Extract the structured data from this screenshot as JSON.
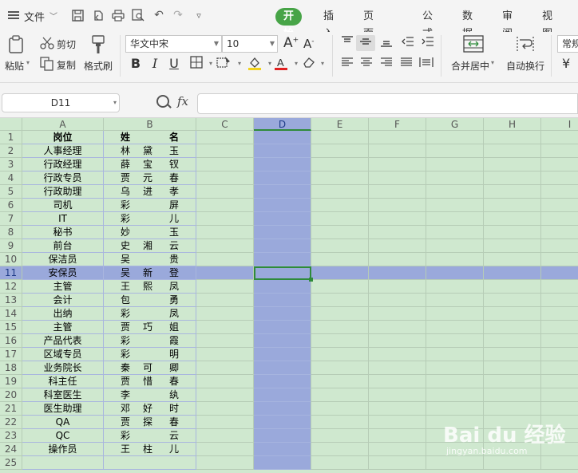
{
  "menubar": {
    "file_label": "文件",
    "tabs": [
      "开始",
      "插入",
      "页面布局",
      "公式",
      "数据",
      "审阅",
      "视图"
    ],
    "active_tab": "开始"
  },
  "ribbon": {
    "paste": "粘贴",
    "cut": "剪切",
    "copy": "复制",
    "format_painter": "格式刷",
    "font_name": "华文中宋",
    "font_size": "10",
    "merge_center": "合并居中",
    "wrap_text": "自动换行",
    "number_format": "常规"
  },
  "formula_bar": {
    "cell_ref": "D11",
    "fx": "fx",
    "formula": ""
  },
  "grid": {
    "columns": [
      "A",
      "B",
      "C",
      "D",
      "E",
      "F",
      "G",
      "H",
      "I"
    ],
    "selected_column": "D",
    "selected_row": 11,
    "header_row": {
      "position": "岗位",
      "name": "姓名"
    },
    "rows": [
      {
        "row": 2,
        "position": "人事经理",
        "name": [
          "林",
          "黛",
          "玉"
        ]
      },
      {
        "row": 3,
        "position": "行政经理",
        "name": [
          "薛",
          "宝",
          "钗"
        ]
      },
      {
        "row": 4,
        "position": "行政专员",
        "name": [
          "贾",
          "元",
          "春"
        ]
      },
      {
        "row": 5,
        "position": "行政助理",
        "name": [
          "乌",
          "进",
          "孝"
        ]
      },
      {
        "row": 6,
        "position": "司机",
        "name": [
          "彩",
          "",
          "屏"
        ]
      },
      {
        "row": 7,
        "position": "IT",
        "name": [
          "彩",
          "",
          "儿"
        ]
      },
      {
        "row": 8,
        "position": "秘书",
        "name": [
          "妙",
          "",
          "玉"
        ]
      },
      {
        "row": 9,
        "position": "前台",
        "name": [
          "史",
          "湘",
          "云"
        ]
      },
      {
        "row": 10,
        "position": "保洁员",
        "name": [
          "吴",
          "",
          "贵"
        ]
      },
      {
        "row": 11,
        "position": "安保员",
        "name": [
          "吴",
          "新",
          "登"
        ]
      },
      {
        "row": 12,
        "position": "主管",
        "name": [
          "王",
          "熙",
          "凤"
        ]
      },
      {
        "row": 13,
        "position": "会计",
        "name": [
          "包",
          "",
          "勇"
        ]
      },
      {
        "row": 14,
        "position": "出纳",
        "name": [
          "彩",
          "",
          "凤"
        ]
      },
      {
        "row": 15,
        "position": "主管",
        "name": [
          "贾",
          "巧",
          "姐"
        ]
      },
      {
        "row": 16,
        "position": "产品代表",
        "name": [
          "彩",
          "",
          "霞"
        ]
      },
      {
        "row": 17,
        "position": "区域专员",
        "name": [
          "彩",
          "",
          "明"
        ]
      },
      {
        "row": 18,
        "position": "业务院长",
        "name": [
          "秦",
          "可",
          "卿"
        ]
      },
      {
        "row": 19,
        "position": "科主任",
        "name": [
          "贾",
          "惜",
          "春"
        ]
      },
      {
        "row": 20,
        "position": "科室医生",
        "name": [
          "李",
          "",
          "纨"
        ]
      },
      {
        "row": 21,
        "position": "医生助理",
        "name": [
          "邓",
          "好",
          "时"
        ]
      },
      {
        "row": 22,
        "position": "QA",
        "name": [
          "贾",
          "探",
          "春"
        ]
      },
      {
        "row": 23,
        "position": "QC",
        "name": [
          "彩",
          "",
          "云"
        ]
      },
      {
        "row": 24,
        "position": "操作员",
        "name": [
          "王",
          "柱",
          "儿"
        ]
      },
      {
        "row": 25,
        "position": "",
        "name": [
          "",
          "",
          ""
        ]
      }
    ]
  },
  "watermark": {
    "brand": "Bai du 经验",
    "url": "jingyan.baidu.com"
  }
}
